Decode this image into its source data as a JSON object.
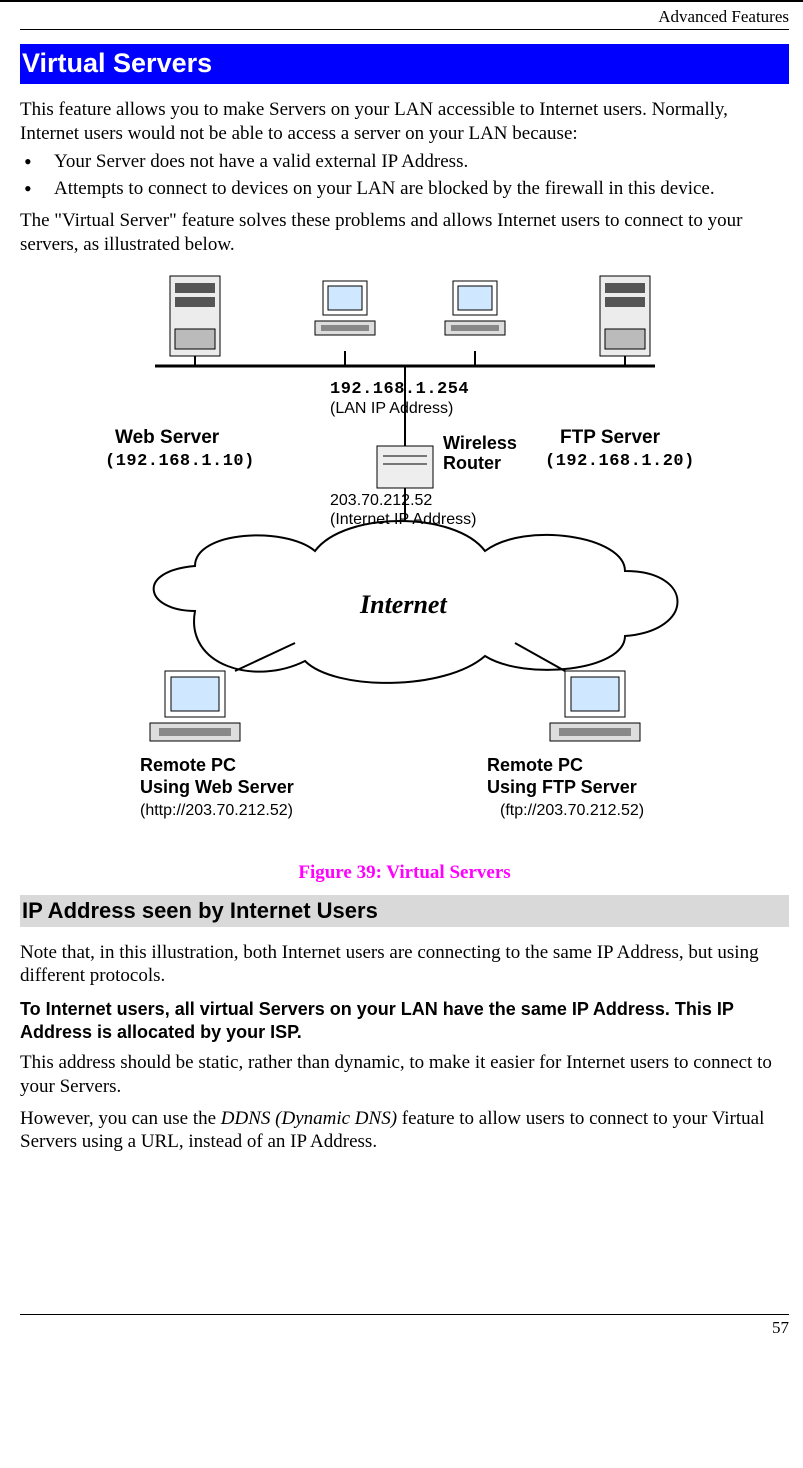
{
  "header": {
    "running": "Advanced Features"
  },
  "section": {
    "title": "Virtual Servers"
  },
  "body": {
    "intro": "This feature allows you to make Servers on your LAN accessible to Internet users. Normally, Internet users would not be able to access a server on your LAN because:",
    "bullets": [
      "Your Server does not have a valid external IP Address.",
      "Attempts to connect to devices on your LAN are blocked by the firewall in this device."
    ],
    "after_bullets": "The \"Virtual Server\" feature solves these problems and allows Internet users to connect to your servers, as illustrated below."
  },
  "figure": {
    "caption": "Figure 39: Virtual Servers",
    "lan_ip": "192.168.1.254",
    "lan_ip_label": "(LAN IP Address)",
    "router_label1": "Wireless",
    "router_label2": "Router",
    "wan_ip": "203.70.212.52",
    "wan_ip_label": "(Internet IP Address)",
    "web_server": "Web Server",
    "web_server_ip": "(192.168.1.10)",
    "ftp_server": "FTP Server",
    "ftp_server_ip": "(192.168.1.20)",
    "internet": "Internet",
    "remote_web1": "Remote PC",
    "remote_web2": "Using Web Server",
    "remote_web_url": "(http://203.70.212.52)",
    "remote_ftp1": "Remote PC",
    "remote_ftp2": "Using FTP Server",
    "remote_ftp_url": "(ftp://203.70.212.52)"
  },
  "sub": {
    "heading": "IP Address seen by Internet Users",
    "p1": "Note that, in this illustration, both Internet users are connecting to the same IP Address, but using different protocols.",
    "strong": "To Internet users, all virtual Servers on your LAN have the same IP Address. This IP Address is allocated by your ISP.",
    "p2": "This address should be static, rather than dynamic, to make it easier for Internet users to connect to your Servers.",
    "p3a": "However, you can use the ",
    "p3i": "DDNS (Dynamic DNS)",
    "p3b": " feature to allow users to connect to your Virtual Servers using a URL, instead of an IP Address."
  },
  "footer": {
    "page": "57"
  }
}
